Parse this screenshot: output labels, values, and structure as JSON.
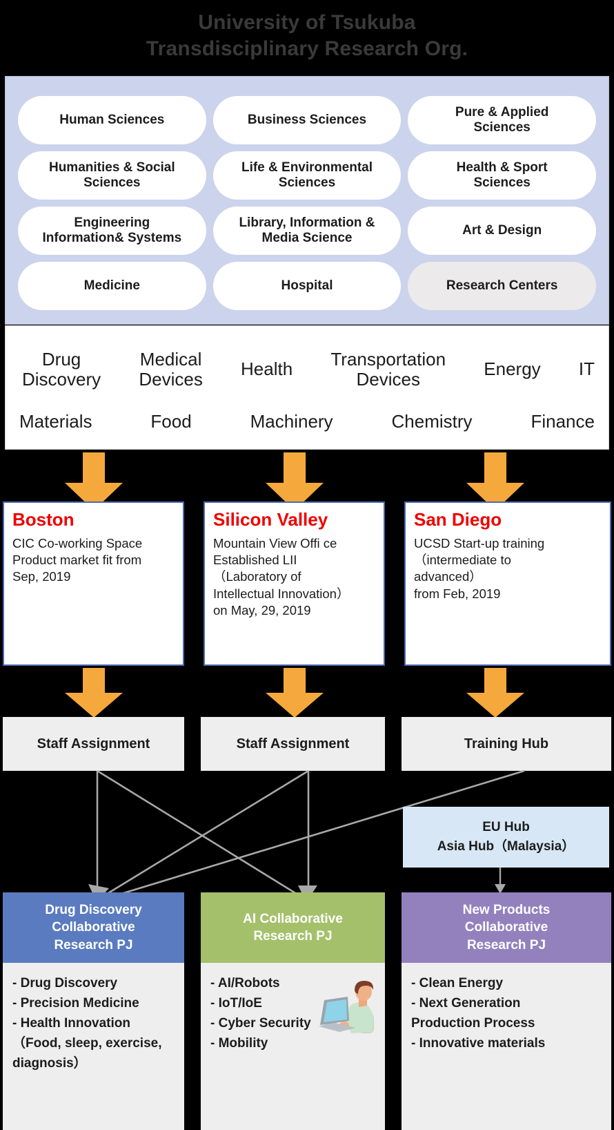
{
  "title": {
    "line1": "University of Tsukuba",
    "line2": "Transdisciplinary Research Org."
  },
  "colors": {
    "title_text": "#3a3a3a",
    "dept_panel_bg": "#ccd3ec",
    "pill_bg": "#ffffff",
    "pill_muted_bg": "#eceaea",
    "arrow_orange": "#f5a93c",
    "loc_border_blue": "#4a69b4",
    "loc_title_red": "#ef0000",
    "hub_bg": "#eeeeee",
    "eu_hub_bg": "#d8e7f5",
    "pj_blue": "#5b7bc0",
    "pj_green": "#a5c06b",
    "pj_purple": "#9381be",
    "connector_gray": "#a8a8a8"
  },
  "departments": [
    {
      "label": "Human Sciences",
      "muted": false
    },
    {
      "label": "Business Sciences",
      "muted": false
    },
    {
      "label": "Pure & Applied\nSciences",
      "muted": false
    },
    {
      "label": "Humanities & Social\nSciences",
      "muted": false
    },
    {
      "label": "Life & Environmental\nSciences",
      "muted": false
    },
    {
      "label": "Health & Sport\nSciences",
      "muted": false
    },
    {
      "label": "Engineering\nInformation& Systems",
      "muted": false
    },
    {
      "label": "Library, Information &\nMedia Science",
      "muted": false
    },
    {
      "label": "Art & Design",
      "muted": false
    },
    {
      "label": "Medicine",
      "muted": false
    },
    {
      "label": "Hospital",
      "muted": false
    },
    {
      "label": "Research Centers",
      "muted": true
    }
  ],
  "fields": {
    "row1": [
      "Drug\nDiscovery",
      "Medical\nDevices",
      "Health",
      "Transportation\nDevices",
      "Energy",
      "IT"
    ],
    "row2": [
      "Materials",
      "Food",
      "Machinery",
      "Chemistry",
      "Finance"
    ]
  },
  "locations": [
    {
      "name": "Boston",
      "body": "CIC Co-working Space\nProduct market fit from\nSep, 2019"
    },
    {
      "name": "Silicon Valley",
      "body": "Mountain View Offi ce\nEstablished LII\n（Laboratory of\nIntellectual Innovation）\non May, 29, 2019"
    },
    {
      "name": "San Diego",
      "body": "UCSD Start-up training\n（intermediate to\nadvanced）\nfrom Feb, 2019"
    }
  ],
  "hubs": [
    {
      "label": "Staff Assignment"
    },
    {
      "label": "Staff Assignment"
    },
    {
      "label": "Training Hub"
    }
  ],
  "regional_hubs": {
    "line1": "EU Hub",
    "line2": "Asia Hub（Malaysia）"
  },
  "projects": [
    {
      "title": "Drug Discovery\nCollaborative\nResearch PJ",
      "color": "#5b7bc0",
      "items": [
        "- Drug Discovery",
        "- Precision Medicine",
        "- Health Innovation\n（Food, sleep, exercise,\n  diagnosis）"
      ]
    },
    {
      "title": "AI Collaborative\nResearch PJ",
      "color": "#a5c06b",
      "items": [
        "- AI/Robots",
        "- IoT/IoE",
        "- Cyber Security",
        "- Mobility"
      ]
    },
    {
      "title": "New Products\nCollaborative\nResearch PJ",
      "color": "#9381be",
      "items": [
        "- Clean Energy",
        "- Next Generation\n  Production Process",
        "- Innovative materials"
      ]
    }
  ]
}
